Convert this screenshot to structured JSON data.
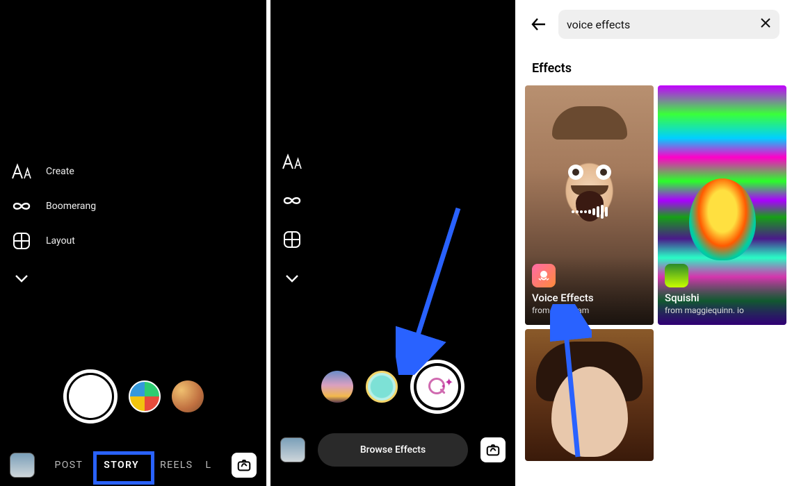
{
  "panel1": {
    "tools": {
      "create": "Create",
      "boomerang": "Boomerang",
      "layout": "Layout"
    },
    "modes": {
      "post": "POST",
      "story": "STORY",
      "reels": "REELS",
      "live": "L"
    }
  },
  "panel2": {
    "browse_button": "Browse Effects"
  },
  "panel3": {
    "search_value": "voice effects",
    "heading": "Effects",
    "cards": [
      {
        "title": "Voice Effects",
        "subtitle": "from instagram"
      },
      {
        "title": "Squishi",
        "subtitle": "from maggiequinn. io"
      }
    ]
  }
}
